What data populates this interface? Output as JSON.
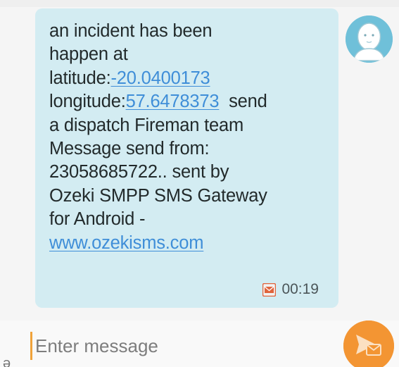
{
  "message": {
    "lines": [
      {
        "text": "an incident has been"
      },
      {
        "text": "happen at"
      },
      {
        "prefix": "latitude:",
        "link": "-20.0400173"
      },
      {
        "prefix": "longitude:",
        "link": "57.6478373",
        "suffix": "  send"
      },
      {
        "text": "a dispatch Fireman team"
      },
      {
        "text": "Message send from:"
      },
      {
        "text": "23058685722.. sent by"
      },
      {
        "text": "Ozeki SMPP SMS Gateway"
      },
      {
        "text": "for Android -"
      },
      {
        "link": "www.ozekisms.com"
      }
    ],
    "time": "00:19",
    "icon": "sms-icon"
  },
  "avatar": {
    "icon": "person-avatar-icon"
  },
  "composer": {
    "placeholder": "Enter message",
    "send_icon": "send-sms-icon",
    "left_glyph": "ə"
  },
  "colors": {
    "bubble": "#d3ecf2",
    "link": "#3f8ed8",
    "avatar": "#6fc0d9",
    "send_button": "#f39533",
    "cursor": "#f0a23a"
  }
}
